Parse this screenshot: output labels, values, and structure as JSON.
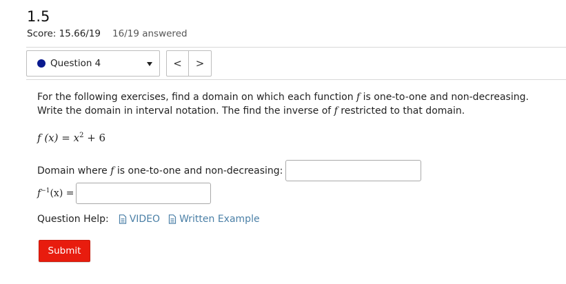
{
  "header": {
    "title": "1.5",
    "score": "Score: 15.66/19",
    "answered": "16/19 answered"
  },
  "question_nav": {
    "selected": "Question 4",
    "status_color": "#0a1a8f",
    "prev_label": "<",
    "next_label": ">"
  },
  "problem": {
    "text_1": "For the following exercises, find a domain on which each function ",
    "func_var_1": "f",
    "text_2": " is one-to-one and non-decreasing. Write the domain in interval notation. The find the inverse of ",
    "func_var_2": "f",
    "text_3": " restricted to that domain.",
    "formula_lhs": "f (x) = x",
    "formula_exp": "2",
    "formula_rhs": " + 6"
  },
  "domain_field": {
    "label_pre": "Domain where ",
    "label_var": "f",
    "label_post": " is one-to-one and non-decreasing:",
    "value": ""
  },
  "inverse_field": {
    "label_f": "f",
    "label_exp": "−1",
    "label_arg": "(x) =",
    "value": ""
  },
  "help": {
    "label": "Question Help:",
    "video": "VIDEO",
    "written": "Written Example"
  },
  "submit_label": "Submit",
  "colors": {
    "submit": "#e81c0e",
    "link": "#4a7fa6"
  }
}
